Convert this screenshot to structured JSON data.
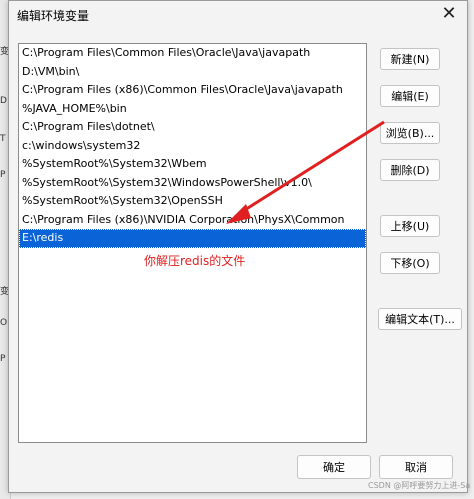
{
  "dialog": {
    "title": "编辑环境变量",
    "close_glyph": "✕"
  },
  "path_list": [
    "C:\\Program Files\\Common Files\\Oracle\\Java\\javapath",
    "D:\\VM\\bin\\",
    "C:\\Program Files (x86)\\Common Files\\Oracle\\Java\\javapath",
    "%JAVA_HOME%\\bin",
    "C:\\Program Files\\dotnet\\",
    "c:\\windows\\system32",
    "%SystemRoot%\\System32\\Wbem",
    "%SystemRoot%\\System32\\WindowsPowerShell\\v1.0\\",
    "%SystemRoot%\\System32\\OpenSSH",
    "C:\\Program Files (x86)\\NVIDIA Corporation\\PhysX\\Common",
    "E:\\redis"
  ],
  "selected_index": 10,
  "buttons": {
    "new": "新建(N)",
    "edit": "编辑(E)",
    "browse": "浏览(B)...",
    "delete": "删除(D)",
    "move_up": "上移(U)",
    "move_down": "下移(O)",
    "edit_text": "编辑文本(T)...",
    "ok": "确定",
    "cancel": "取消"
  },
  "annotation": {
    "text": "你解压redis的文件",
    "color": "#e02020"
  },
  "watermark": "CSDN @阿呼要努力上进-Sa",
  "colors": {
    "selection": "#0a64d8",
    "window_bg": "#f3f3f3"
  }
}
